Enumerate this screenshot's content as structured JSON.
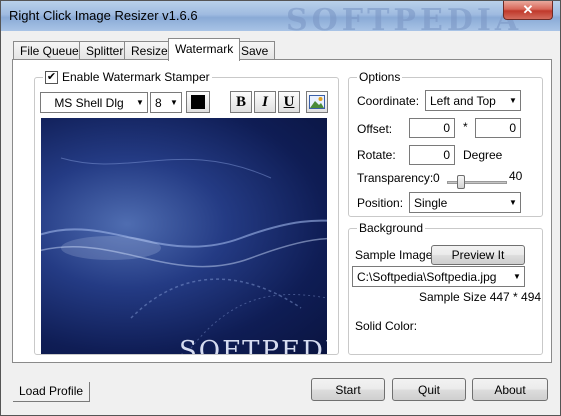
{
  "window": {
    "title": "Right Click Image Resizer v1.6.6",
    "watermark_text": "SOFTPEDIA",
    "close_glyph": "✕"
  },
  "tabs": [
    {
      "label": "File Queue"
    },
    {
      "label": "Splitter"
    },
    {
      "label": "Resize"
    },
    {
      "label": "Watermark"
    },
    {
      "label": "Save"
    }
  ],
  "active_tab": "Watermark",
  "stamper": {
    "enable_label": "Enable Watermark Stamper",
    "enabled_mark": "✔",
    "font_name": "MS Shell Dlg",
    "font_size": "8",
    "text_color": "#000000",
    "bold_label": "B",
    "italic_label": "I",
    "underline_label": "U",
    "picture_icon": "image-icon",
    "preview_watermark": "SOFTPEDI"
  },
  "options": {
    "title": "Options",
    "coordinate_label": "Coordinate:",
    "coordinate_value": "Left and Top",
    "offset_label": "Offset:",
    "offset_x": "0",
    "offset_sep": "*",
    "offset_y": "0",
    "rotate_label": "Rotate:",
    "rotate_value": "0",
    "rotate_unit": "Degree",
    "transparency_label": "Transparency:",
    "transparency_min": "0",
    "transparency_max": "40",
    "transparency_value": 0.2,
    "position_label": "Position:",
    "position_value": "Single"
  },
  "background": {
    "title": "Background",
    "sample_image_label": "Sample Image:",
    "preview_button": "Preview It",
    "sample_path": "C:\\Softpedia\\Softpedia.jpg",
    "sample_size": "Sample Size 447 * 494",
    "solid_color_label": "Solid Color:",
    "solid_color": "#ff00ff"
  },
  "footer": {
    "load_profile": "Load Profile",
    "start": "Start",
    "quit": "Quit",
    "about": "About"
  }
}
